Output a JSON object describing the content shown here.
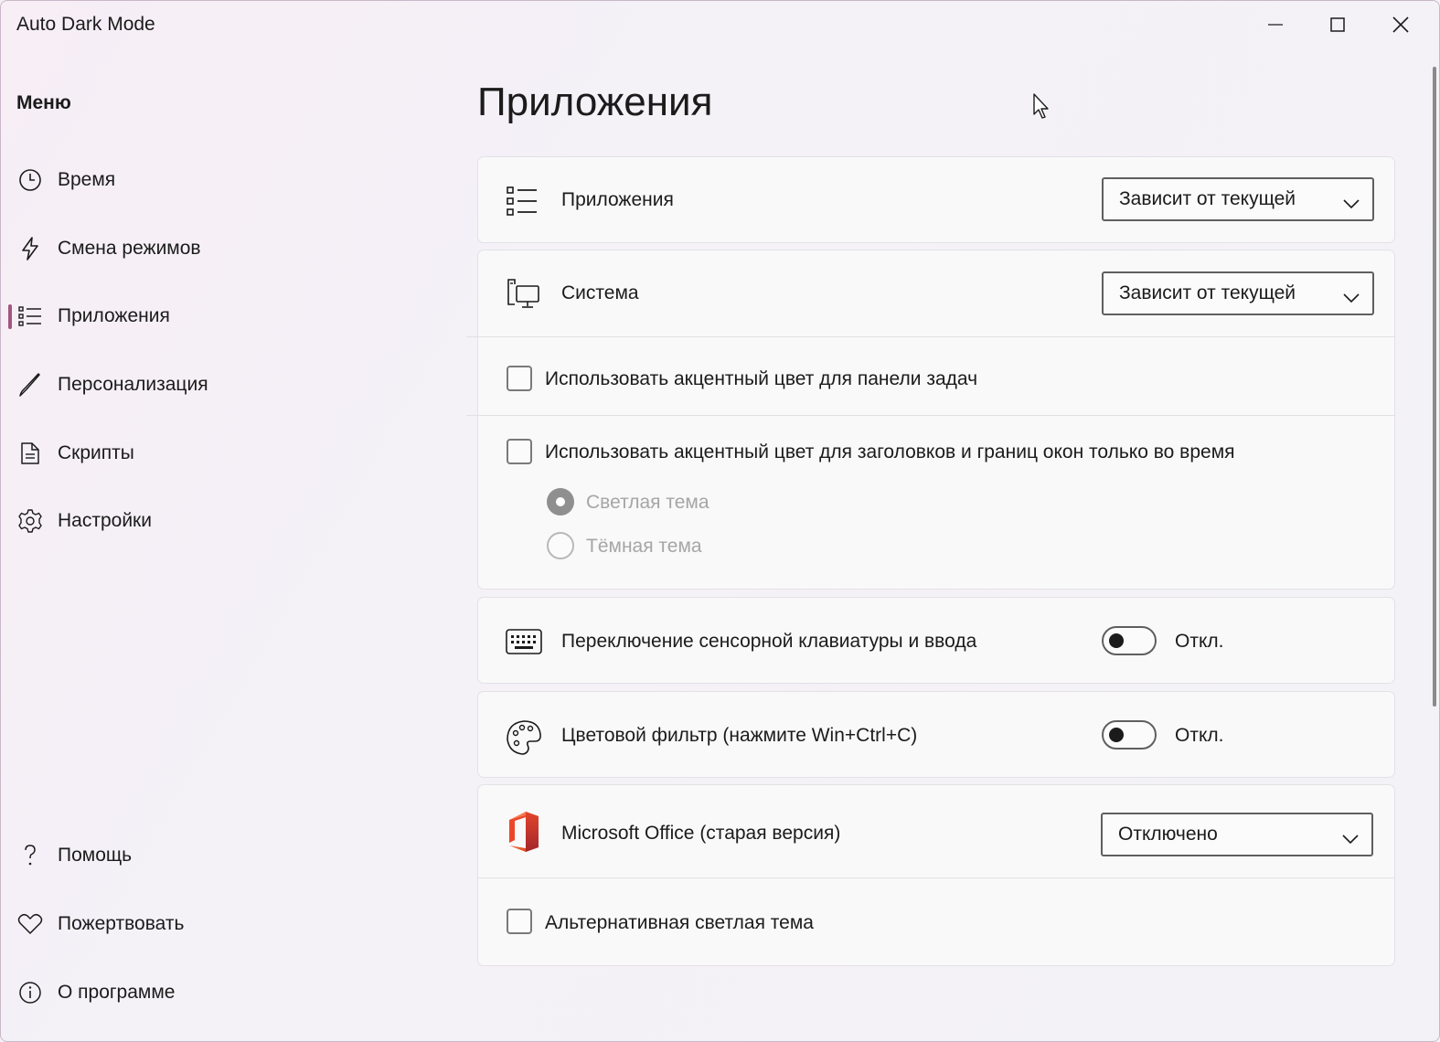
{
  "window": {
    "title": "Auto Dark Mode"
  },
  "sidebar": {
    "menu_title": "Меню",
    "items": [
      {
        "label": "Время",
        "icon": "clock-icon"
      },
      {
        "label": "Смена режимов",
        "icon": "lightning-icon"
      },
      {
        "label": "Приложения",
        "icon": "list-icon",
        "active": true
      },
      {
        "label": "Персонализация",
        "icon": "brush-icon"
      },
      {
        "label": "Скрипты",
        "icon": "document-icon"
      },
      {
        "label": "Настройки",
        "icon": "gear-icon"
      }
    ],
    "footer_items": [
      {
        "label": "Помощь",
        "icon": "help-icon"
      },
      {
        "label": "Пожертвовать",
        "icon": "heart-icon"
      },
      {
        "label": "О программе",
        "icon": "info-icon"
      }
    ]
  },
  "main": {
    "page_title": "Приложения",
    "apps_row": {
      "label": "Приложения",
      "dropdown_value": "Зависит от текущей"
    },
    "system_row": {
      "label": "Система",
      "dropdown_value": "Зависит от текущей"
    },
    "accent_taskbar": {
      "label": "Использовать акцентный цвет для панели задач",
      "checked": false
    },
    "accent_titlebars": {
      "label": "Использовать акцентный цвет для заголовков и границ окон только во время",
      "checked": false,
      "options": [
        "Светлая тема",
        "Тёмная тема"
      ],
      "selected": "Светлая тема"
    },
    "touch_keyboard": {
      "label": "Переключение сенсорной клавиатуры и ввода",
      "state_label": "Откл.",
      "on": false
    },
    "color_filter": {
      "label": "Цветовой фильтр (нажмите Win+Ctrl+C)",
      "state_label": "Откл.",
      "on": false
    },
    "office_row": {
      "label": "Microsoft Office (старая версия)",
      "dropdown_value": "Отключено"
    },
    "alt_light_theme": {
      "label": "Альтернативная светлая тема",
      "checked": false
    }
  },
  "colors": {
    "accent": "#a3567f",
    "office_logo": "#e2452b"
  }
}
